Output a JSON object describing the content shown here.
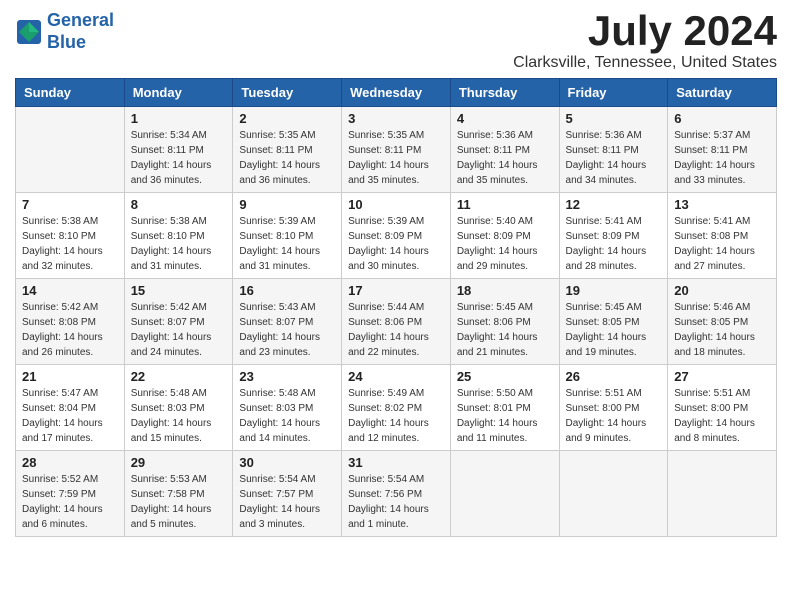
{
  "logo": {
    "line1": "General",
    "line2": "Blue"
  },
  "title": "July 2024",
  "location": "Clarksville, Tennessee, United States",
  "days_of_week": [
    "Sunday",
    "Monday",
    "Tuesday",
    "Wednesday",
    "Thursday",
    "Friday",
    "Saturday"
  ],
  "weeks": [
    [
      {
        "day": "",
        "sunrise": "",
        "sunset": "",
        "daylight": ""
      },
      {
        "day": "1",
        "sunrise": "Sunrise: 5:34 AM",
        "sunset": "Sunset: 8:11 PM",
        "daylight": "Daylight: 14 hours and 36 minutes."
      },
      {
        "day": "2",
        "sunrise": "Sunrise: 5:35 AM",
        "sunset": "Sunset: 8:11 PM",
        "daylight": "Daylight: 14 hours and 36 minutes."
      },
      {
        "day": "3",
        "sunrise": "Sunrise: 5:35 AM",
        "sunset": "Sunset: 8:11 PM",
        "daylight": "Daylight: 14 hours and 35 minutes."
      },
      {
        "day": "4",
        "sunrise": "Sunrise: 5:36 AM",
        "sunset": "Sunset: 8:11 PM",
        "daylight": "Daylight: 14 hours and 35 minutes."
      },
      {
        "day": "5",
        "sunrise": "Sunrise: 5:36 AM",
        "sunset": "Sunset: 8:11 PM",
        "daylight": "Daylight: 14 hours and 34 minutes."
      },
      {
        "day": "6",
        "sunrise": "Sunrise: 5:37 AM",
        "sunset": "Sunset: 8:11 PM",
        "daylight": "Daylight: 14 hours and 33 minutes."
      }
    ],
    [
      {
        "day": "7",
        "sunrise": "Sunrise: 5:38 AM",
        "sunset": "Sunset: 8:10 PM",
        "daylight": "Daylight: 14 hours and 32 minutes."
      },
      {
        "day": "8",
        "sunrise": "Sunrise: 5:38 AM",
        "sunset": "Sunset: 8:10 PM",
        "daylight": "Daylight: 14 hours and 31 minutes."
      },
      {
        "day": "9",
        "sunrise": "Sunrise: 5:39 AM",
        "sunset": "Sunset: 8:10 PM",
        "daylight": "Daylight: 14 hours and 31 minutes."
      },
      {
        "day": "10",
        "sunrise": "Sunrise: 5:39 AM",
        "sunset": "Sunset: 8:09 PM",
        "daylight": "Daylight: 14 hours and 30 minutes."
      },
      {
        "day": "11",
        "sunrise": "Sunrise: 5:40 AM",
        "sunset": "Sunset: 8:09 PM",
        "daylight": "Daylight: 14 hours and 29 minutes."
      },
      {
        "day": "12",
        "sunrise": "Sunrise: 5:41 AM",
        "sunset": "Sunset: 8:09 PM",
        "daylight": "Daylight: 14 hours and 28 minutes."
      },
      {
        "day": "13",
        "sunrise": "Sunrise: 5:41 AM",
        "sunset": "Sunset: 8:08 PM",
        "daylight": "Daylight: 14 hours and 27 minutes."
      }
    ],
    [
      {
        "day": "14",
        "sunrise": "Sunrise: 5:42 AM",
        "sunset": "Sunset: 8:08 PM",
        "daylight": "Daylight: 14 hours and 26 minutes."
      },
      {
        "day": "15",
        "sunrise": "Sunrise: 5:42 AM",
        "sunset": "Sunset: 8:07 PM",
        "daylight": "Daylight: 14 hours and 24 minutes."
      },
      {
        "day": "16",
        "sunrise": "Sunrise: 5:43 AM",
        "sunset": "Sunset: 8:07 PM",
        "daylight": "Daylight: 14 hours and 23 minutes."
      },
      {
        "day": "17",
        "sunrise": "Sunrise: 5:44 AM",
        "sunset": "Sunset: 8:06 PM",
        "daylight": "Daylight: 14 hours and 22 minutes."
      },
      {
        "day": "18",
        "sunrise": "Sunrise: 5:45 AM",
        "sunset": "Sunset: 8:06 PM",
        "daylight": "Daylight: 14 hours and 21 minutes."
      },
      {
        "day": "19",
        "sunrise": "Sunrise: 5:45 AM",
        "sunset": "Sunset: 8:05 PM",
        "daylight": "Daylight: 14 hours and 19 minutes."
      },
      {
        "day": "20",
        "sunrise": "Sunrise: 5:46 AM",
        "sunset": "Sunset: 8:05 PM",
        "daylight": "Daylight: 14 hours and 18 minutes."
      }
    ],
    [
      {
        "day": "21",
        "sunrise": "Sunrise: 5:47 AM",
        "sunset": "Sunset: 8:04 PM",
        "daylight": "Daylight: 14 hours and 17 minutes."
      },
      {
        "day": "22",
        "sunrise": "Sunrise: 5:48 AM",
        "sunset": "Sunset: 8:03 PM",
        "daylight": "Daylight: 14 hours and 15 minutes."
      },
      {
        "day": "23",
        "sunrise": "Sunrise: 5:48 AM",
        "sunset": "Sunset: 8:03 PM",
        "daylight": "Daylight: 14 hours and 14 minutes."
      },
      {
        "day": "24",
        "sunrise": "Sunrise: 5:49 AM",
        "sunset": "Sunset: 8:02 PM",
        "daylight": "Daylight: 14 hours and 12 minutes."
      },
      {
        "day": "25",
        "sunrise": "Sunrise: 5:50 AM",
        "sunset": "Sunset: 8:01 PM",
        "daylight": "Daylight: 14 hours and 11 minutes."
      },
      {
        "day": "26",
        "sunrise": "Sunrise: 5:51 AM",
        "sunset": "Sunset: 8:00 PM",
        "daylight": "Daylight: 14 hours and 9 minutes."
      },
      {
        "day": "27",
        "sunrise": "Sunrise: 5:51 AM",
        "sunset": "Sunset: 8:00 PM",
        "daylight": "Daylight: 14 hours and 8 minutes."
      }
    ],
    [
      {
        "day": "28",
        "sunrise": "Sunrise: 5:52 AM",
        "sunset": "Sunset: 7:59 PM",
        "daylight": "Daylight: 14 hours and 6 minutes."
      },
      {
        "day": "29",
        "sunrise": "Sunrise: 5:53 AM",
        "sunset": "Sunset: 7:58 PM",
        "daylight": "Daylight: 14 hours and 5 minutes."
      },
      {
        "day": "30",
        "sunrise": "Sunrise: 5:54 AM",
        "sunset": "Sunset: 7:57 PM",
        "daylight": "Daylight: 14 hours and 3 minutes."
      },
      {
        "day": "31",
        "sunrise": "Sunrise: 5:54 AM",
        "sunset": "Sunset: 7:56 PM",
        "daylight": "Daylight: 14 hours and 1 minute."
      },
      {
        "day": "",
        "sunrise": "",
        "sunset": "",
        "daylight": ""
      },
      {
        "day": "",
        "sunrise": "",
        "sunset": "",
        "daylight": ""
      },
      {
        "day": "",
        "sunrise": "",
        "sunset": "",
        "daylight": ""
      }
    ]
  ]
}
